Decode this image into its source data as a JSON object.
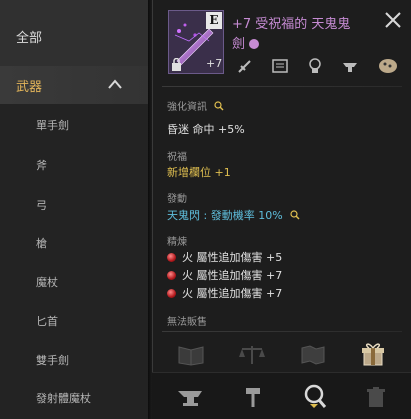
{
  "sidebar": {
    "top_label": "全部",
    "category": {
      "label": "武器",
      "expanded": true
    },
    "items": [
      "單手劍",
      "斧",
      "弓",
      "槍",
      "魔杖",
      "匕首",
      "雙手劍",
      "發射體魔杖"
    ]
  },
  "tooltip": {
    "grade": "E",
    "enhance_badge": "+7",
    "title": "+7 受祝福的 天鬼鬼劍",
    "header_icons": [
      "dagger-icon",
      "card-icon",
      "enchant-icon",
      "anvil-icon",
      "pouch-icon"
    ],
    "enhance_label": "強化資訊",
    "enhance_value": "昏迷 命中 +5%",
    "blessing_label": "祝福",
    "blessing_value": "新增欄位 +1",
    "trigger_label": "發動",
    "trigger_value": "天鬼閃 : 發動機率 10%",
    "essence_label": "精煉",
    "essences": [
      "火 屬性追加傷害 +5",
      "火 屬性追加傷害 +7",
      "火 屬性追加傷害 +7"
    ],
    "note": "無法販售",
    "action_icons": [
      "book-icon",
      "scale-icon",
      "map-icon",
      "gift-box-icon"
    ],
    "bottom_icons": [
      "anvil-icon",
      "hammer-icon",
      "search-icon",
      "trash-icon"
    ]
  },
  "colors": {
    "title": "#c68bd3",
    "gold": "#e0bf50",
    "cyan": "#5fbedc",
    "essence_dot": "#b2181c"
  }
}
